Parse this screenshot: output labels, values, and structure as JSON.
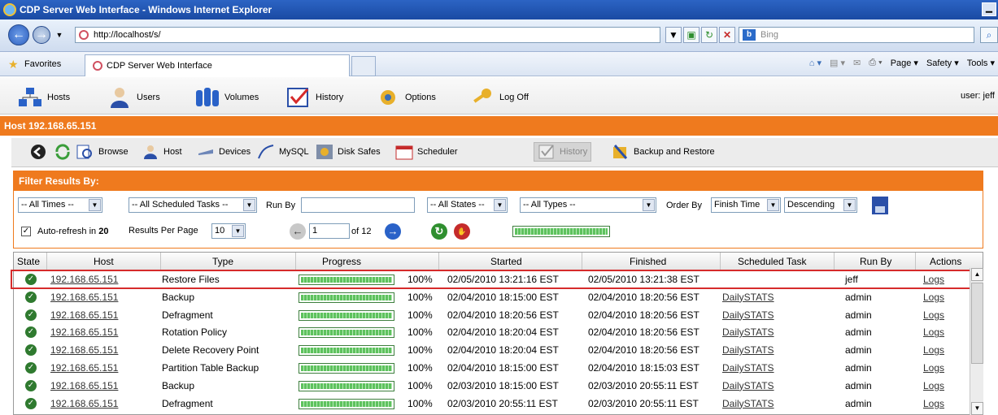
{
  "window": {
    "title": "CDP Server Web Interface - Windows Internet Explorer"
  },
  "browser": {
    "url": "http://localhost/s/",
    "search_placeholder": "Bing",
    "favorites_label": "Favorites",
    "tab_title": "CDP Server Web Interface",
    "cmd": {
      "page": "Page ▾",
      "safety": "Safety ▾",
      "tools": "Tools ▾"
    }
  },
  "app_toolbar": {
    "items": [
      "Hosts",
      "Users",
      "Volumes",
      "History",
      "Options",
      "Log Off"
    ],
    "user": "user: jeff"
  },
  "host_title": "Host 192.168.65.151",
  "sub_toolbar": {
    "items": [
      "Browse",
      "Host",
      "Devices",
      "MySQL",
      "Disk Safes",
      "Scheduler",
      "History",
      "Backup and Restore"
    ]
  },
  "filter": {
    "title": "Filter Results By:",
    "times": "-- All Times --",
    "tasks": "-- All Scheduled Tasks --",
    "run_by_label": "Run By",
    "run_by_value": "",
    "states": "-- All States --",
    "types": "-- All Types --",
    "order_by_label": "Order By",
    "order_by": "Finish Time",
    "direction": "Descending",
    "autorefresh_label": "Auto-refresh in",
    "autorefresh_seconds": "20",
    "results_per_page_label": "Results Per Page",
    "results_per_page": "10",
    "page": "1",
    "of_pages": "of 12"
  },
  "grid": {
    "columns": [
      "State",
      "Host",
      "Type",
      "Progress",
      "Started",
      "Finished",
      "Scheduled Task",
      "Run By",
      "Actions"
    ],
    "rows": [
      {
        "host": "192.168.65.151",
        "type": "Restore Files",
        "progress": "100%",
        "started": "02/05/2010 13:21:16 EST",
        "finished": "02/05/2010 13:21:38 EST",
        "task": "",
        "run_by": "jeff",
        "action": "Logs"
      },
      {
        "host": "192.168.65.151",
        "type": "Backup",
        "progress": "100%",
        "started": "02/04/2010 18:15:00 EST",
        "finished": "02/04/2010 18:20:56 EST",
        "task": "DailySTATS",
        "run_by": "admin",
        "action": "Logs"
      },
      {
        "host": "192.168.65.151",
        "type": "Defragment",
        "progress": "100%",
        "started": "02/04/2010 18:20:56 EST",
        "finished": "02/04/2010 18:20:56 EST",
        "task": "DailySTATS",
        "run_by": "admin",
        "action": "Logs"
      },
      {
        "host": "192.168.65.151",
        "type": "Rotation Policy",
        "progress": "100%",
        "started": "02/04/2010 18:20:04 EST",
        "finished": "02/04/2010 18:20:56 EST",
        "task": "DailySTATS",
        "run_by": "admin",
        "action": "Logs"
      },
      {
        "host": "192.168.65.151",
        "type": "Delete Recovery Point",
        "progress": "100%",
        "started": "02/04/2010 18:20:04 EST",
        "finished": "02/04/2010 18:20:56 EST",
        "task": "DailySTATS",
        "run_by": "admin",
        "action": "Logs"
      },
      {
        "host": "192.168.65.151",
        "type": "Partition Table Backup",
        "progress": "100%",
        "started": "02/04/2010 18:15:00 EST",
        "finished": "02/04/2010 18:15:03 EST",
        "task": "DailySTATS",
        "run_by": "admin",
        "action": "Logs"
      },
      {
        "host": "192.168.65.151",
        "type": "Backup",
        "progress": "100%",
        "started": "02/03/2010 18:15:00 EST",
        "finished": "02/03/2010 20:55:11 EST",
        "task": "DailySTATS",
        "run_by": "admin",
        "action": "Logs"
      },
      {
        "host": "192.168.65.151",
        "type": "Defragment",
        "progress": "100%",
        "started": "02/03/2010 20:55:11 EST",
        "finished": "02/03/2010 20:55:11 EST",
        "task": "DailySTATS",
        "run_by": "admin",
        "action": "Logs"
      }
    ]
  },
  "colors": {
    "accent": "#ef7a1e",
    "highlight": "#d62b2b",
    "success": "#2f7a2f"
  }
}
